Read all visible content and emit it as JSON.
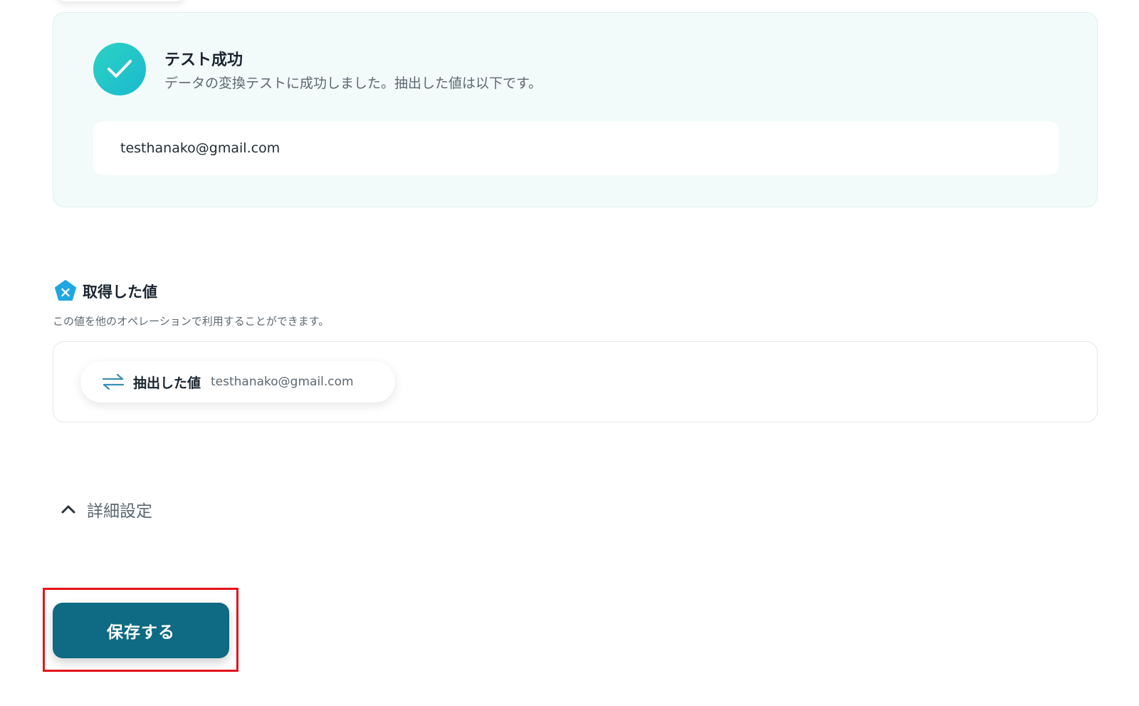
{
  "test_result": {
    "title": "テスト成功",
    "message": "データの変換テストに成功しました。抽出した値は以下です。",
    "extracted_value": "testhanako@gmail.com"
  },
  "acquired_values": {
    "title": "取得した値",
    "description": "この値を他のオペレーションで利用することができます。",
    "items": [
      {
        "label": "抽出した値",
        "value": "testhanako@gmail.com"
      }
    ]
  },
  "advanced_settings": {
    "label": "詳細設定"
  },
  "actions": {
    "save_label": "保存する"
  },
  "colors": {
    "accent": "#0f6a83",
    "success": "#1fc4c9",
    "highlight": "#e4141b",
    "badge": "#1ea7e0"
  },
  "icons": {
    "success": "check-circle-icon",
    "acquired_values": "x-badge-icon",
    "value_item": "swap-arrows-icon",
    "advanced_toggle": "chevron-up-icon"
  }
}
